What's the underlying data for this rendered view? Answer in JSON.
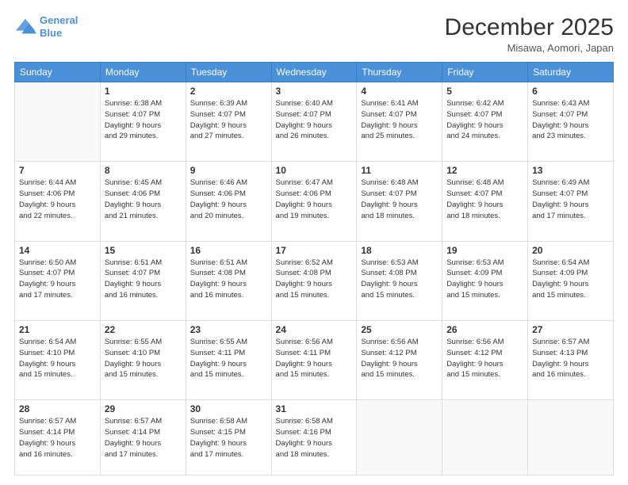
{
  "header": {
    "logo_line1": "General",
    "logo_line2": "Blue",
    "month": "December 2025",
    "location": "Misawa, Aomori, Japan"
  },
  "weekdays": [
    "Sunday",
    "Monday",
    "Tuesday",
    "Wednesday",
    "Thursday",
    "Friday",
    "Saturday"
  ],
  "weeks": [
    [
      {
        "day": "",
        "info": ""
      },
      {
        "day": "1",
        "info": "Sunrise: 6:38 AM\nSunset: 4:07 PM\nDaylight: 9 hours\nand 29 minutes."
      },
      {
        "day": "2",
        "info": "Sunrise: 6:39 AM\nSunset: 4:07 PM\nDaylight: 9 hours\nand 27 minutes."
      },
      {
        "day": "3",
        "info": "Sunrise: 6:40 AM\nSunset: 4:07 PM\nDaylight: 9 hours\nand 26 minutes."
      },
      {
        "day": "4",
        "info": "Sunrise: 6:41 AM\nSunset: 4:07 PM\nDaylight: 9 hours\nand 25 minutes."
      },
      {
        "day": "5",
        "info": "Sunrise: 6:42 AM\nSunset: 4:07 PM\nDaylight: 9 hours\nand 24 minutes."
      },
      {
        "day": "6",
        "info": "Sunrise: 6:43 AM\nSunset: 4:07 PM\nDaylight: 9 hours\nand 23 minutes."
      }
    ],
    [
      {
        "day": "7",
        "info": "Sunrise: 6:44 AM\nSunset: 4:06 PM\nDaylight: 9 hours\nand 22 minutes."
      },
      {
        "day": "8",
        "info": "Sunrise: 6:45 AM\nSunset: 4:06 PM\nDaylight: 9 hours\nand 21 minutes."
      },
      {
        "day": "9",
        "info": "Sunrise: 6:46 AM\nSunset: 4:06 PM\nDaylight: 9 hours\nand 20 minutes."
      },
      {
        "day": "10",
        "info": "Sunrise: 6:47 AM\nSunset: 4:06 PM\nDaylight: 9 hours\nand 19 minutes."
      },
      {
        "day": "11",
        "info": "Sunrise: 6:48 AM\nSunset: 4:07 PM\nDaylight: 9 hours\nand 18 minutes."
      },
      {
        "day": "12",
        "info": "Sunrise: 6:48 AM\nSunset: 4:07 PM\nDaylight: 9 hours\nand 18 minutes."
      },
      {
        "day": "13",
        "info": "Sunrise: 6:49 AM\nSunset: 4:07 PM\nDaylight: 9 hours\nand 17 minutes."
      }
    ],
    [
      {
        "day": "14",
        "info": "Sunrise: 6:50 AM\nSunset: 4:07 PM\nDaylight: 9 hours\nand 17 minutes."
      },
      {
        "day": "15",
        "info": "Sunrise: 6:51 AM\nSunset: 4:07 PM\nDaylight: 9 hours\nand 16 minutes."
      },
      {
        "day": "16",
        "info": "Sunrise: 6:51 AM\nSunset: 4:08 PM\nDaylight: 9 hours\nand 16 minutes."
      },
      {
        "day": "17",
        "info": "Sunrise: 6:52 AM\nSunset: 4:08 PM\nDaylight: 9 hours\nand 15 minutes."
      },
      {
        "day": "18",
        "info": "Sunrise: 6:53 AM\nSunset: 4:08 PM\nDaylight: 9 hours\nand 15 minutes."
      },
      {
        "day": "19",
        "info": "Sunrise: 6:53 AM\nSunset: 4:09 PM\nDaylight: 9 hours\nand 15 minutes."
      },
      {
        "day": "20",
        "info": "Sunrise: 6:54 AM\nSunset: 4:09 PM\nDaylight: 9 hours\nand 15 minutes."
      }
    ],
    [
      {
        "day": "21",
        "info": "Sunrise: 6:54 AM\nSunset: 4:10 PM\nDaylight: 9 hours\nand 15 minutes."
      },
      {
        "day": "22",
        "info": "Sunrise: 6:55 AM\nSunset: 4:10 PM\nDaylight: 9 hours\nand 15 minutes."
      },
      {
        "day": "23",
        "info": "Sunrise: 6:55 AM\nSunset: 4:11 PM\nDaylight: 9 hours\nand 15 minutes."
      },
      {
        "day": "24",
        "info": "Sunrise: 6:56 AM\nSunset: 4:11 PM\nDaylight: 9 hours\nand 15 minutes."
      },
      {
        "day": "25",
        "info": "Sunrise: 6:56 AM\nSunset: 4:12 PM\nDaylight: 9 hours\nand 15 minutes."
      },
      {
        "day": "26",
        "info": "Sunrise: 6:56 AM\nSunset: 4:12 PM\nDaylight: 9 hours\nand 15 minutes."
      },
      {
        "day": "27",
        "info": "Sunrise: 6:57 AM\nSunset: 4:13 PM\nDaylight: 9 hours\nand 16 minutes."
      }
    ],
    [
      {
        "day": "28",
        "info": "Sunrise: 6:57 AM\nSunset: 4:14 PM\nDaylight: 9 hours\nand 16 minutes."
      },
      {
        "day": "29",
        "info": "Sunrise: 6:57 AM\nSunset: 4:14 PM\nDaylight: 9 hours\nand 17 minutes."
      },
      {
        "day": "30",
        "info": "Sunrise: 6:58 AM\nSunset: 4:15 PM\nDaylight: 9 hours\nand 17 minutes."
      },
      {
        "day": "31",
        "info": "Sunrise: 6:58 AM\nSunset: 4:16 PM\nDaylight: 9 hours\nand 18 minutes."
      },
      {
        "day": "",
        "info": ""
      },
      {
        "day": "",
        "info": ""
      },
      {
        "day": "",
        "info": ""
      }
    ]
  ]
}
